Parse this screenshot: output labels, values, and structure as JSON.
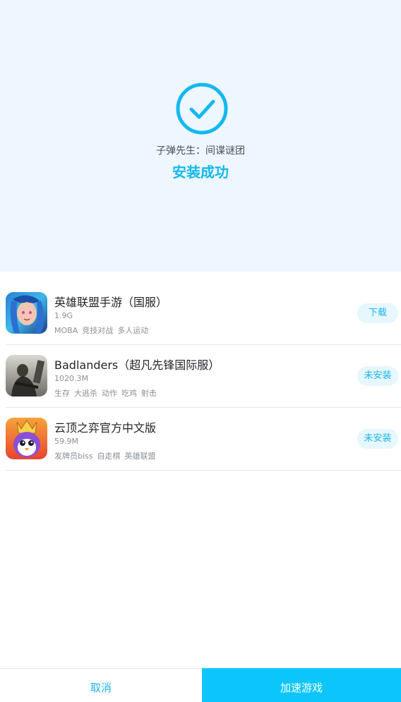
{
  "header": {
    "game_name": "子弹先生：间谍谜团",
    "status": "安装成功",
    "accent_color": "#14b8f0",
    "icon": "check-circle-icon"
  },
  "games": [
    {
      "title": "英雄联盟手游（国服）",
      "size": "1.9G",
      "tags": [
        "MOBA",
        "竞技对战",
        "多人运动"
      ],
      "action": "下载",
      "icon": "league-mobile-app-icon"
    },
    {
      "title": "Badlanders（超凡先锋国际服）",
      "size": "1020.3M",
      "tags": [
        "生存",
        "大逃杀",
        "动作",
        "吃鸡",
        "射击"
      ],
      "action": "未安装",
      "icon": "badlanders-app-icon"
    },
    {
      "title": "云顶之弈官方中文版",
      "size": "59.9M",
      "tags": [
        "发牌员biss",
        "自走棋",
        "英雄联盟"
      ],
      "action": "未安装",
      "icon": "tft-app-icon"
    }
  ],
  "footer": {
    "cancel": "取消",
    "accelerate": "加速游戏"
  }
}
